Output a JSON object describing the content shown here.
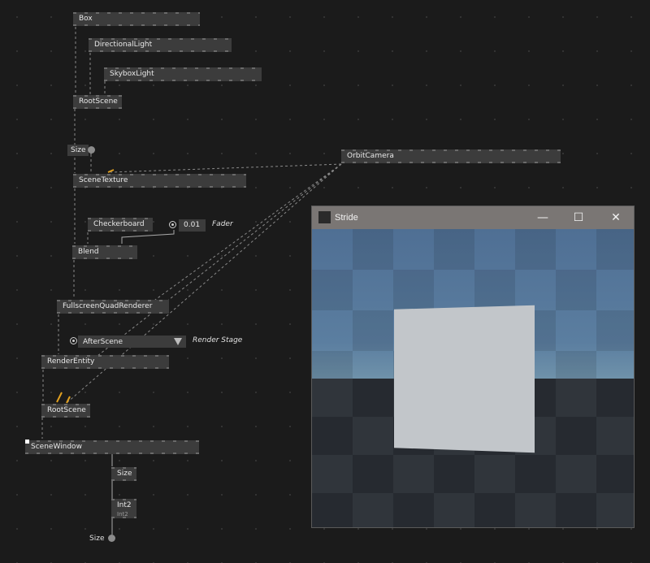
{
  "nodes": {
    "box": "Box",
    "directional_light": "DirectionalLight",
    "skybox_light": "SkyboxLight",
    "root_scene_top": "RootScene",
    "size_pin": "Size",
    "scene_texture": "SceneTexture",
    "checkerboard": "Checkerboard",
    "fader_value": "0.01",
    "fader_label": "Fader",
    "blend": "Blend",
    "fullscreen_quad_renderer": "FullscreenQuadRenderer",
    "after_scene": "AfterScene",
    "render_stage_label": "Render Stage",
    "render_entity": "RenderEntity",
    "root_scene_bottom": "RootScene",
    "scene_window": "SceneWindow",
    "size_node": "Size",
    "int2": "Int2",
    "int2_sub": "Int2",
    "size_output": "Size",
    "orbit_camera": "OrbitCamera"
  },
  "stride_window": {
    "title": "Stride",
    "minimize": "—",
    "maximize": "☐",
    "close": "✕"
  },
  "colors": {
    "canvas_bg": "#1b1b1b",
    "node_bg": "#3c3c3c",
    "link_highlight": "#e0a020",
    "titlebar": "#7a7674"
  }
}
